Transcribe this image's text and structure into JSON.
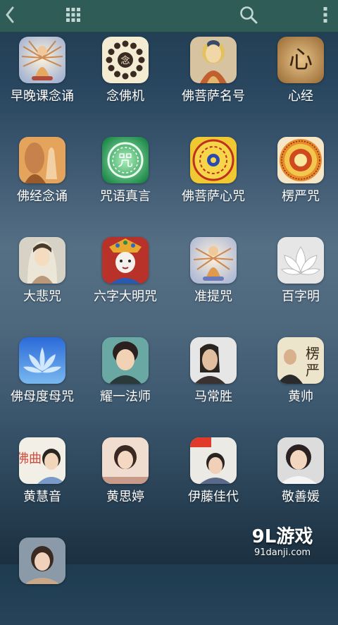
{
  "toolbar": {
    "back_icon": "chevron-left-icon",
    "grid_icon": "grid-icon",
    "search_icon": "search-icon",
    "menu_icon": "more-vertical-icon",
    "background_color": "#2f5c57"
  },
  "apps": [
    {
      "label": "早晚课念诵",
      "icon": "avalokiteshvara-thousand-arms-icon"
    },
    {
      "label": "念佛机",
      "icon": "prayer-beads-icon"
    },
    {
      "label": "佛菩萨名号",
      "icon": "buddha-portrait-icon"
    },
    {
      "label": "心经",
      "icon": "heart-calligraphy-icon"
    },
    {
      "label": "佛经念诵",
      "icon": "praying-hands-icon"
    },
    {
      "label": "咒语真言",
      "icon": "green-mantra-icon"
    },
    {
      "label": "佛菩萨心咒",
      "icon": "tibetan-mandala-icon"
    },
    {
      "label": "楞严咒",
      "icon": "mandala-icon"
    },
    {
      "label": "大悲咒",
      "icon": "guanyin-portrait-icon"
    },
    {
      "label": "六字大明咒",
      "icon": "tibetan-deity-icon"
    },
    {
      "label": "准提咒",
      "icon": "cundi-bodhisattva-icon"
    },
    {
      "label": "百字明",
      "icon": "lotus-flower-icon"
    },
    {
      "label": "佛母度母咒",
      "icon": "blue-lotus-icon"
    },
    {
      "label": "耀一法师",
      "icon": "portrait-singer-icon"
    },
    {
      "label": "马常胜",
      "icon": "portrait-man-icon"
    },
    {
      "label": "黄帅",
      "icon": "calligraphy-portrait-icon"
    },
    {
      "label": "黄慧音",
      "icon": "album-cover-icon"
    },
    {
      "label": "黄思婷",
      "icon": "album-cover-icon"
    },
    {
      "label": "伊藤佳代",
      "icon": "album-cover-icon"
    },
    {
      "label": "敬善媛",
      "icon": "portrait-woman-icon"
    },
    {
      "label": "",
      "icon": "portrait-woman-icon"
    }
  ],
  "watermark": {
    "logo_text": "9L游戏",
    "url_text": "91danji.com"
  }
}
